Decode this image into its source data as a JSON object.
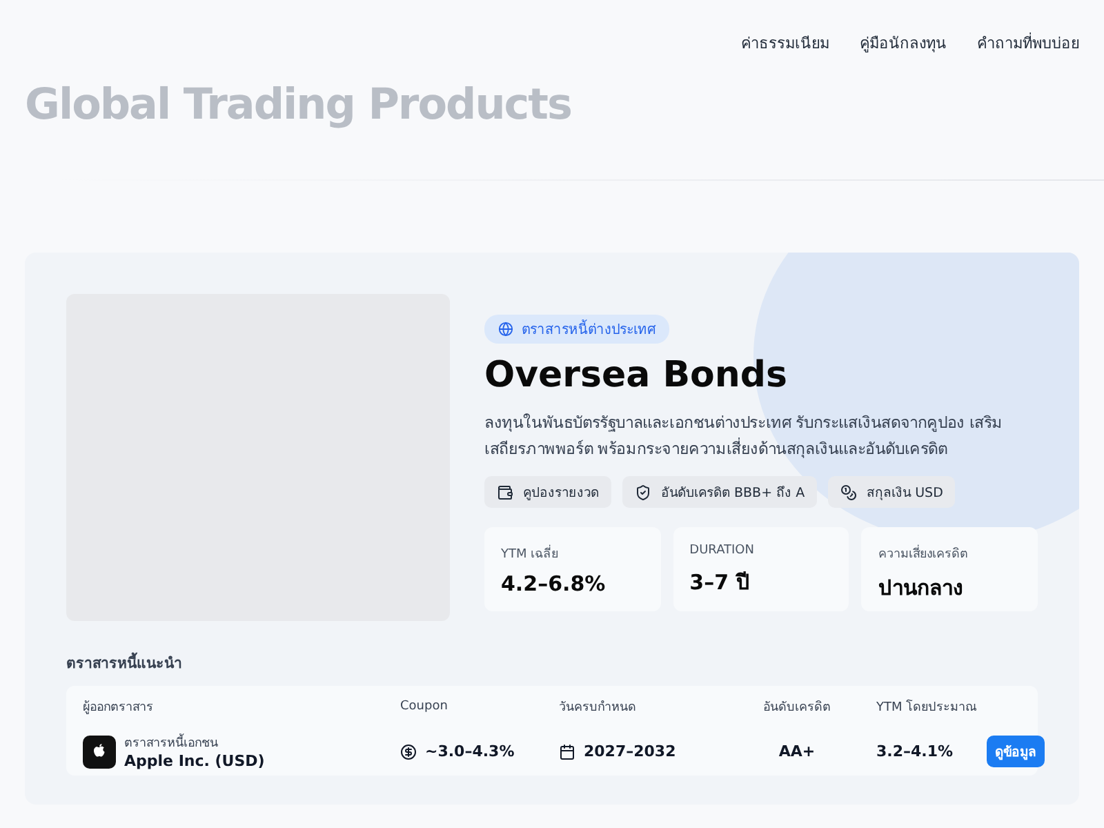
{
  "nav": [
    {
      "label": "ค่าธรรมเนียม"
    },
    {
      "label": "คู่มือนักลงทุน"
    },
    {
      "label": "คำถามที่พบบ่อย"
    }
  ],
  "page_title": "Global Trading Products",
  "product": {
    "badge": "ตราสารหนี้ต่างประเทศ",
    "title": "Oversea Bonds",
    "description": "ลงทุนในพันธบัตรรัฐบาลและเอกชนต่างประเทศ รับกระแสเงินสดจากคูปอง เสริมเสถียรภาพพอร์ต พร้อมกระจายความเสี่ยงด้านสกุลเงินและอันดับเครดิต",
    "chips": [
      {
        "kind": "wallet",
        "label": "คูปองรายงวด"
      },
      {
        "kind": "shield",
        "label": "อันดับเครดิต BBB+ ถึง A"
      },
      {
        "kind": "coins",
        "label": "สกุลเงิน USD"
      }
    ],
    "stats": [
      {
        "label": "YTM เฉลี่ย",
        "value": "4.2–6.8%"
      },
      {
        "label": "DURATION",
        "value": "3–7 ปี"
      },
      {
        "label": "ความเสี่ยงเครดิต",
        "value": "ปานกลาง"
      }
    ]
  },
  "recommended": {
    "heading": "ตราสารหนี้แนะนำ",
    "columns": [
      "ผู้ออกตราสาร",
      "Coupon",
      "วันครบกำหนด",
      "อันดับเครดิต",
      "YTM โดยประมาณ"
    ],
    "rows": [
      {
        "type": "ตราสารหนี้เอกชน",
        "issuer": "Apple Inc. (USD)",
        "coupon": "~3.0–4.3%",
        "maturity": "2027–2032",
        "rating": "AA+",
        "ytm": "3.2–4.1%",
        "action": "ดูข้อมูล"
      }
    ]
  }
}
